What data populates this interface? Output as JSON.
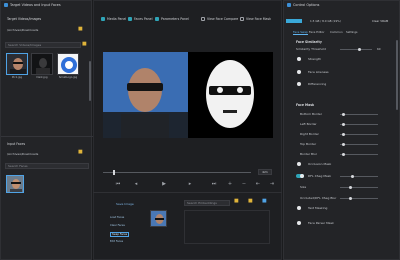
{
  "left": {
    "title": "Target Videos and Input Faces",
    "target_header": "Target Videos/Images",
    "target_path": "\\Archives\\Downloads",
    "target_search_placeholder": "Search Videos/Images",
    "targets": [
      {
        "caption": "Pic1.jpg"
      },
      {
        "caption": "Dark.jpg"
      },
      {
        "caption": "SmallLogo.jpg"
      }
    ],
    "input_header": "Input Faces",
    "input_path": "\\Archives\\Downloads",
    "input_search_placeholder": "Search Faces"
  },
  "toolbar": {
    "items": [
      {
        "label": "Media Panel",
        "checked": true
      },
      {
        "label": "Faces Panel",
        "checked": true
      },
      {
        "label": "Parameters Panel",
        "checked": true
      },
      {
        "label": "View Face Compare",
        "checked": false
      },
      {
        "label": "View Face Mask",
        "checked": false
      }
    ]
  },
  "player": {
    "frame_value": "421",
    "controls": [
      "first-frame",
      "previous",
      "play",
      "next",
      "last-frame",
      "add-marker",
      "remove-marker",
      "prev-marker",
      "next-marker",
      "settings"
    ],
    "control_glyphs": [
      "⏮",
      "◂",
      "▶",
      "▸",
      "⏭",
      "+",
      "−",
      "⇤",
      "⇥",
      "⚙"
    ],
    "seek_fraction": 0.07
  },
  "faces": {
    "save_image_label": "Save Image",
    "buttons": [
      "Load Faces",
      "Clear Faces",
      "Swap Faces",
      "Edit Faces"
    ],
    "search_placeholder": "Search Embeddings"
  },
  "right": {
    "title": "Control Options",
    "status": "1.5 GB / 8.0 GB (19%)",
    "clear_vram": "Clear VRAM",
    "tabs": [
      "Face Swap",
      "Face Editor",
      "Common",
      "Settings"
    ],
    "active_tab": 0,
    "face_similarity_header": "Face Similarity",
    "similarity_threshold_label": "Similarity Threshold",
    "similarity_threshold_value": "60",
    "similarity_threshold_fraction": 0.6,
    "radios": [
      {
        "label": "Strength"
      },
      {
        "label": "Face Likeness"
      },
      {
        "label": "Differencing"
      }
    ],
    "face_mask_header": "Face Mask",
    "mask_rows": [
      {
        "label": "Bottom Border",
        "fraction": 0.1
      },
      {
        "label": "Left Border",
        "fraction": 0.1
      },
      {
        "label": "Right Border",
        "fraction": 0.1
      },
      {
        "label": "Top Border",
        "fraction": 0.1
      },
      {
        "label": "Border Blur",
        "fraction": 0.1
      }
    ],
    "occlusion_mask_label": "Occlusion Mask",
    "dfl_xseg_label": "DFL XSeg Mask",
    "size_label": "Size",
    "occluded_label": "Occluded/DFL XSeg Blur",
    "text_masking_label": "Text Masking",
    "face_parser_label": "Face Parser Mask"
  },
  "colors": {
    "accent": "#2fa5b8",
    "blue": "#4fa3e6",
    "panel": "#232427",
    "background": "#1b1c1e"
  }
}
